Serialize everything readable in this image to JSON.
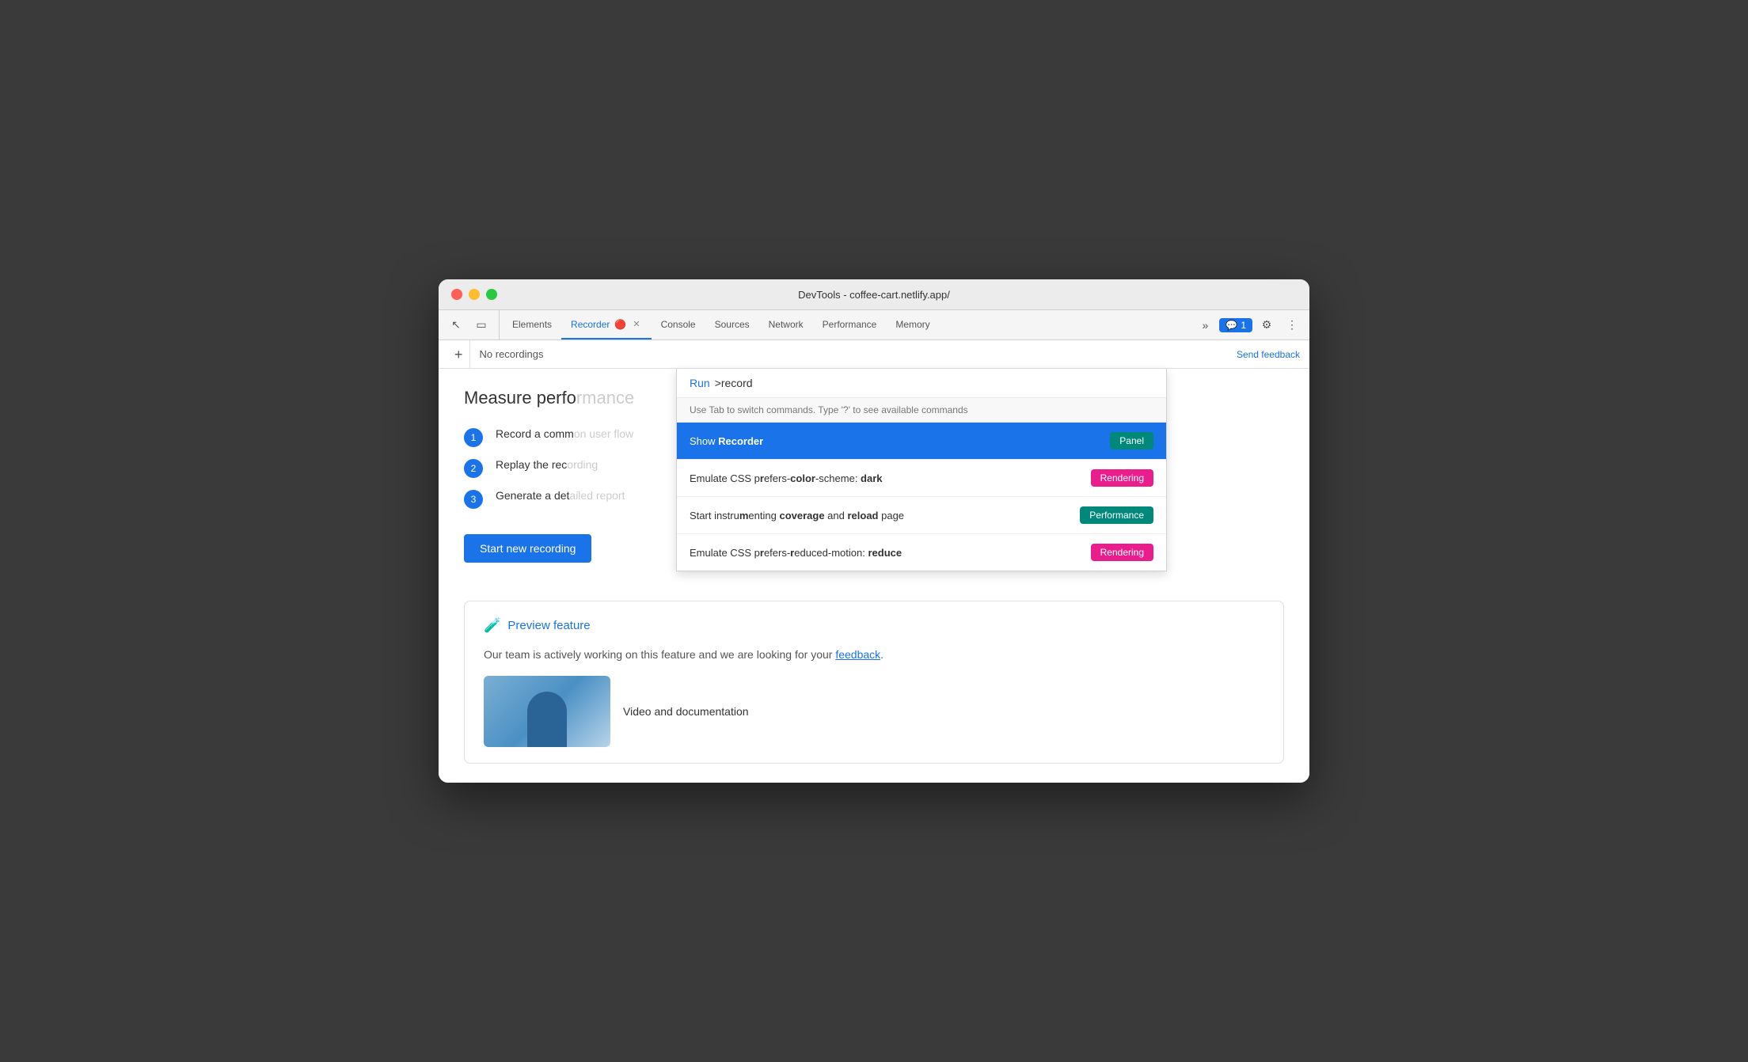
{
  "window": {
    "title": "DevTools - coffee-cart.netlify.app/"
  },
  "tabs": [
    {
      "id": "elements",
      "label": "Elements",
      "active": false
    },
    {
      "id": "recorder",
      "label": "Recorder",
      "active": true,
      "closable": true
    },
    {
      "id": "console",
      "label": "Console",
      "active": false
    },
    {
      "id": "sources",
      "label": "Sources",
      "active": false
    },
    {
      "id": "network",
      "label": "Network",
      "active": false
    },
    {
      "id": "performance",
      "label": "Performance",
      "active": false
    },
    {
      "id": "memory",
      "label": "Memory",
      "active": false
    }
  ],
  "toolbar": {
    "feedback_label": "💬 1",
    "more_label": "⋯"
  },
  "sub_bar": {
    "add_label": "+",
    "no_recordings": "No recordings",
    "send_feedback": "Send feedback"
  },
  "command_palette": {
    "run_label": "Run",
    "input_value": ">record",
    "hint": "Use Tab to switch commands. Type '?' to see available commands",
    "items": [
      {
        "id": "show-recorder",
        "label_plain": "Show ",
        "label_highlight": "Recorder",
        "label_suffix": "",
        "badge_label": "Panel",
        "badge_class": "badge-panel",
        "selected": true
      },
      {
        "id": "css-dark",
        "label_plain": "Emulate CSS p",
        "label_highlight": "r",
        "label_mid": "efers-",
        "label_highlight2": "color",
        "label_suffix": "-scheme: dark",
        "badge_label": "Rendering",
        "badge_class": "badge-rendering",
        "selected": false
      },
      {
        "id": "coverage",
        "label_plain": "Start instru",
        "label_highlight": "m",
        "label_mid": "enting ",
        "label_highlight2": "coverage",
        "label_suffix": " and reload page",
        "badge_label": "Performance",
        "badge_class": "badge-performance",
        "selected": false
      },
      {
        "id": "css-motion",
        "label_plain": "Emulate CSS p",
        "label_highlight": "r",
        "label_mid": "efers-reduced-motion: r",
        "label_highlight2": "educe",
        "label_suffix": "",
        "badge_label": "Rendering",
        "badge_class": "badge-rendering",
        "selected": false
      }
    ]
  },
  "main": {
    "measure_title": "Measure perfo",
    "steps": [
      {
        "num": "1",
        "text": "Record a comm"
      },
      {
        "num": "2",
        "text": "Replay the rec"
      },
      {
        "num": "3",
        "text": "Generate a det"
      }
    ],
    "start_btn": "Start new recording",
    "preview": {
      "icon": "🧪",
      "title": "Preview feature",
      "text_before": "Our team is actively working on this feature and we are looking for your ",
      "link_text": "feedback",
      "text_after": ".",
      "video_label": "Video and documentation"
    }
  }
}
